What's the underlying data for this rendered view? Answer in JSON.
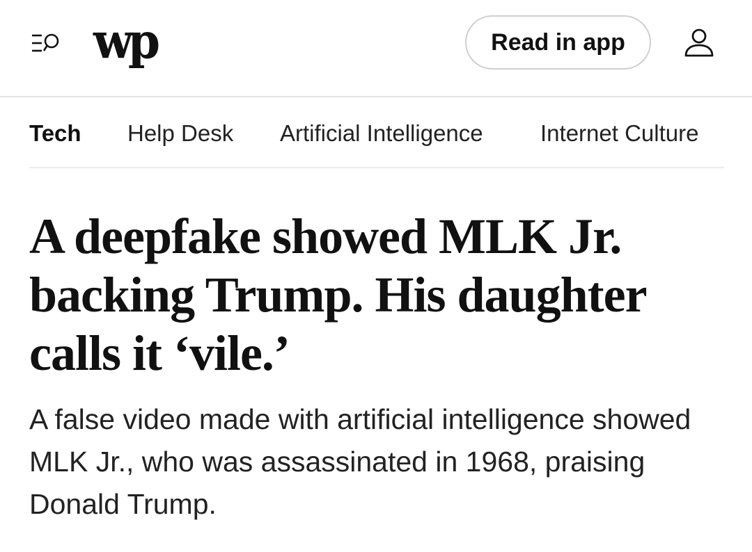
{
  "header": {
    "menu_search_icon": "menu-search-icon",
    "logo_text": "wp",
    "read_in_app_label": "Read in app",
    "account_icon": "user-icon"
  },
  "subnav": {
    "items": [
      {
        "label": "Tech",
        "active": true
      },
      {
        "label": "Help Desk",
        "active": false
      },
      {
        "label": "Artificial Intelligence",
        "active": false
      },
      {
        "label": "Internet Culture",
        "active": false
      }
    ]
  },
  "article": {
    "headline": "A deepfake showed MLK Jr. backing Trump. His daughter calls it ‘vile.’",
    "dek": "A false video made with artificial intelligence showed MLK Jr., who was assassinated in 1968, praising Donald Trump."
  },
  "colors": {
    "text": "#111111",
    "divider": "#e3e3e3",
    "button_border": "#cfcfcf"
  }
}
